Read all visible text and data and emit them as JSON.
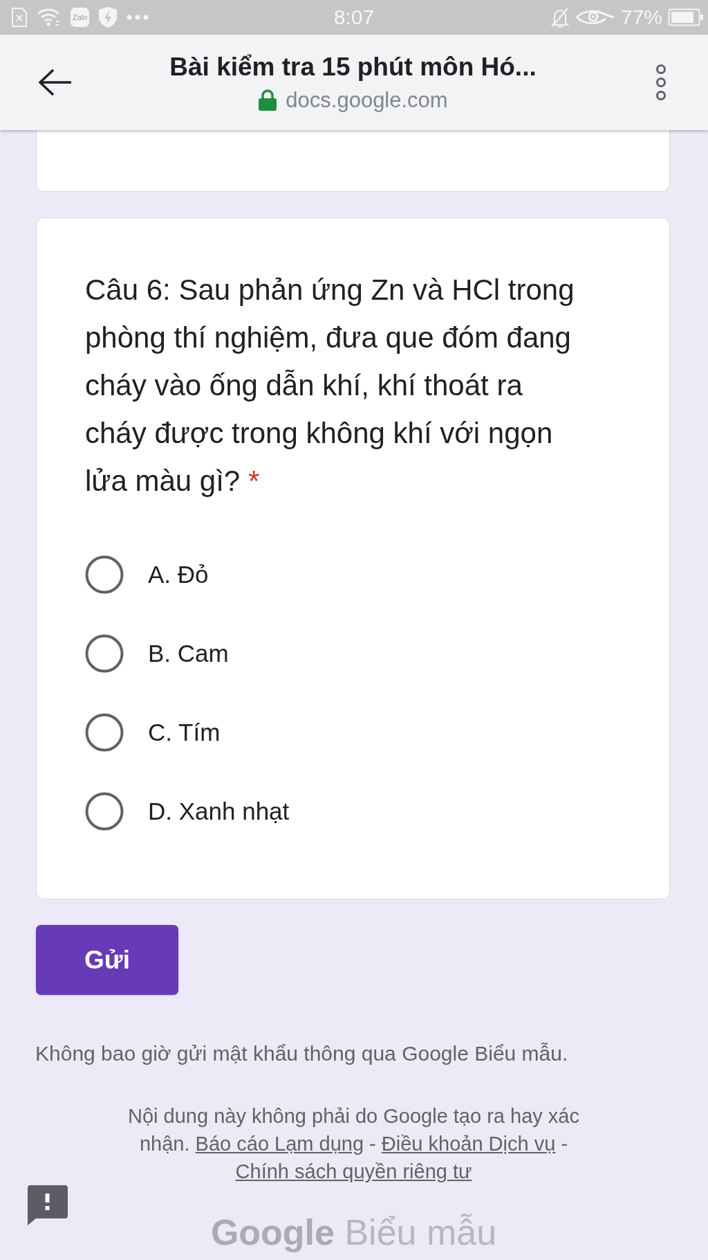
{
  "status_bar": {
    "app_badge": "Zalo",
    "time": "8:07",
    "battery": "77%"
  },
  "toolbar": {
    "title": "Bài kiểm tra 15 phút môn Hó...",
    "url": "docs.google.com"
  },
  "question": {
    "text": "Câu 6: Sau phản ứng Zn và HCl trong phòng thí nghiệm, đưa que đóm đang cháy vào ống dẫn khí, khí thoát ra cháy được trong không khí với ngọn lửa màu gì?",
    "required_mark": "*",
    "options": [
      {
        "label": "A. Đỏ",
        "selected": false
      },
      {
        "label": "B. Cam",
        "selected": false
      },
      {
        "label": "C. Tím",
        "selected": false
      },
      {
        "label": "D. Xanh nhạt",
        "selected": false
      }
    ]
  },
  "submit_button": "Gửi",
  "password_warning": "Không bao giờ gửi mật khẩu thông qua Google Biểu mẫu.",
  "disclaimer": {
    "text": "Nội dung này không phải do Google tạo ra hay xác nhận.",
    "links": [
      "Báo cáo Lạm dụng",
      "Điều khoản Dịch vụ",
      "Chính sách quyền riêng tư"
    ],
    "separators": [
      "-",
      "-"
    ]
  },
  "logo": {
    "brand": "Google",
    "product": "Biểu mẫu"
  }
}
